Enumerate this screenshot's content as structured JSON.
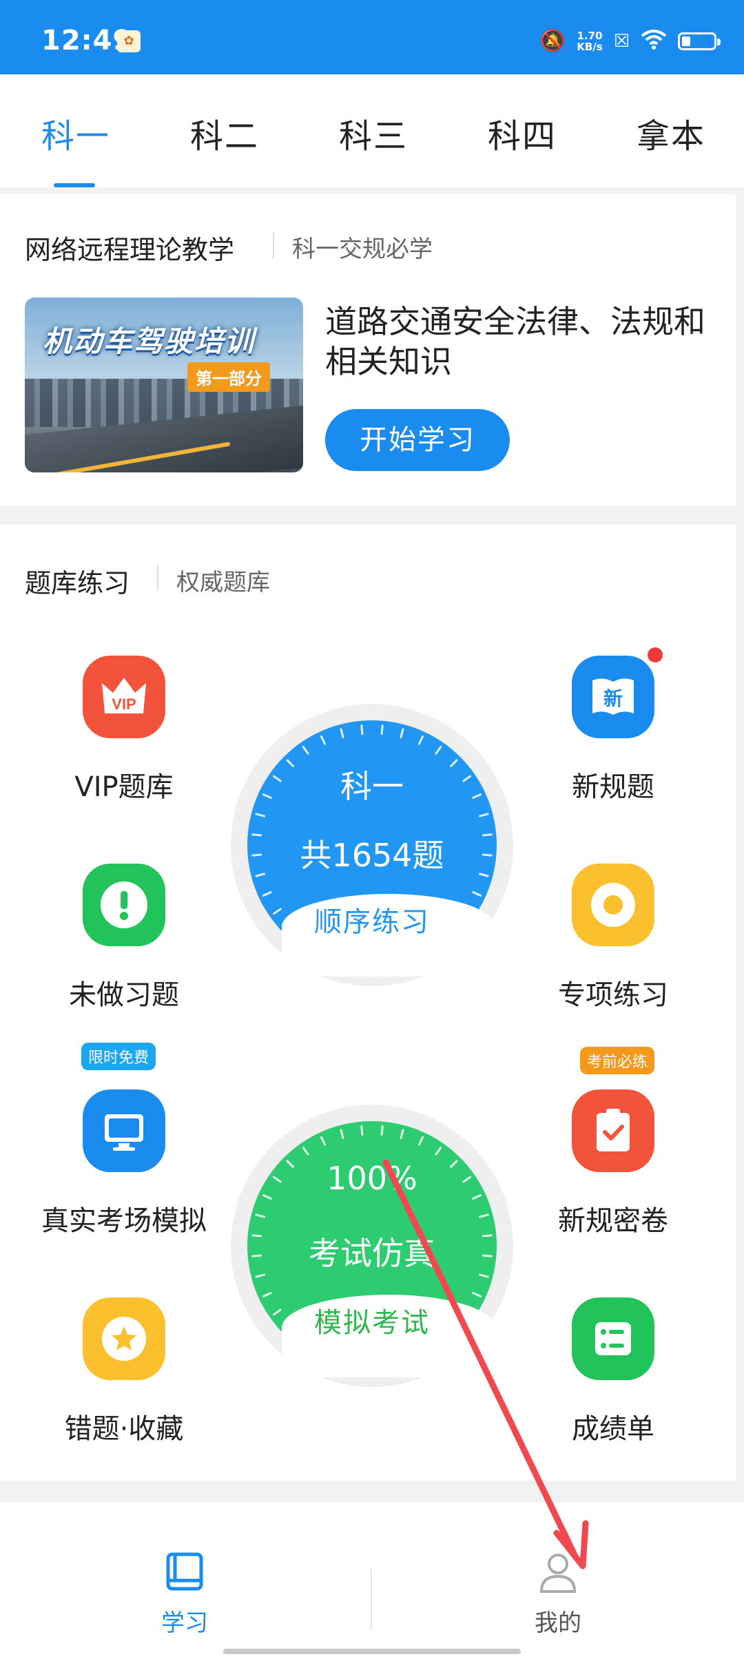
{
  "status_bar": {
    "time": "12:49",
    "speed_value": "1.70",
    "speed_unit": "KB/s"
  },
  "tabs": [
    {
      "label": "科一",
      "active": true
    },
    {
      "label": "科二",
      "active": false
    },
    {
      "label": "科三",
      "active": false
    },
    {
      "label": "科四",
      "active": false
    },
    {
      "label": "拿本",
      "active": false
    }
  ],
  "remote_course": {
    "title": "网络远程理论教学",
    "subtitle": "科一交规必学",
    "thumbnail_title": "机动车驾驶培训",
    "thumbnail_tag": "第一部分",
    "lesson_title": "道路交通安全法律、法规和相关知识",
    "start_button": "开始学习"
  },
  "question_bank": {
    "title": "题库练习",
    "subtitle": "权威题库",
    "features": [
      {
        "label": "VIP题库",
        "icon": "crown-vip-icon",
        "color": "#f4533b"
      },
      {
        "label": "新规题",
        "icon": "new-book-icon",
        "color": "#1a8cf0",
        "dot": true
      },
      {
        "label": "未做习题",
        "icon": "exclamation-icon",
        "color": "#22c35a"
      },
      {
        "label": "专项练习",
        "icon": "target-icon",
        "color": "#fbc02d"
      },
      {
        "label": "真实考场模拟",
        "icon": "monitor-icon",
        "color": "#1a8cf0",
        "badge": "限时免费"
      },
      {
        "label": "新规密卷",
        "icon": "clipboard-check-icon",
        "color": "#f4533b",
        "badge": "考前必练"
      },
      {
        "label": "错题·收藏",
        "icon": "star-icon",
        "color": "#fbc02d"
      },
      {
        "label": "成绩单",
        "icon": "list-icon",
        "color": "#22c35a"
      }
    ],
    "gauge_sequence": {
      "title": "科一",
      "count": "共1654题",
      "action": "顺序练习",
      "color": "#2196f3"
    },
    "gauge_exam": {
      "percent": "100%",
      "title": "考试仿真",
      "action": "模拟考试",
      "color": "#2ecc71"
    }
  },
  "bottom_nav": [
    {
      "label": "学习",
      "icon": "book-icon",
      "active": true
    },
    {
      "label": "我的",
      "icon": "person-icon",
      "active": false
    }
  ]
}
